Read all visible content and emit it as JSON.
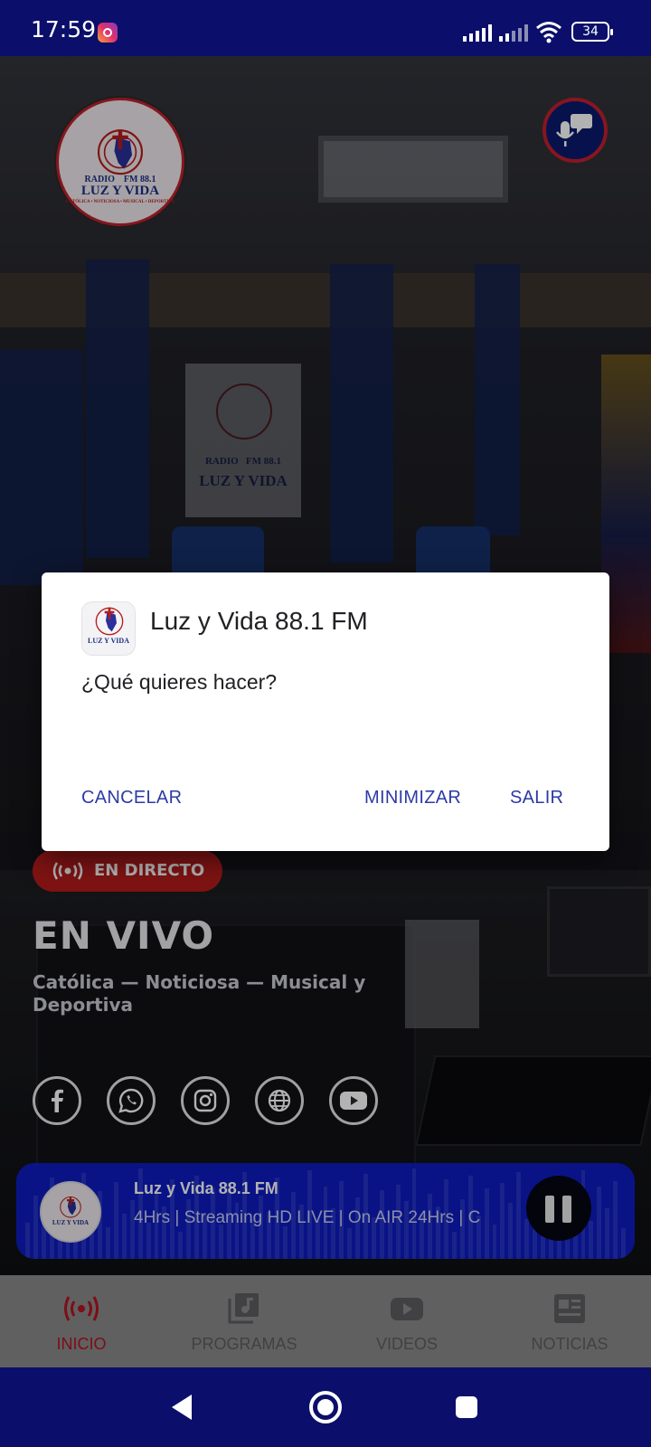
{
  "status_bar": {
    "time": "17:59",
    "battery": "34"
  },
  "logo": {
    "radio": "RADIO",
    "fm": "FM 88.1",
    "name": "LUZ Y VIDA",
    "tagline": "CATÓLICA • NOTICIOSA • MUSICAL • DEPORTIVA"
  },
  "poster": {
    "radio": "RADIO",
    "fm": "FM 88.1",
    "name": "LUZ Y VIDA"
  },
  "live": {
    "badge": "EN DIRECTO",
    "title": "EN VIVO",
    "subtitle": "Católica — Noticiosa — Musical y Deportiva"
  },
  "socials": [
    "facebook-icon",
    "whatsapp-icon",
    "instagram-icon",
    "globe-icon",
    "youtube-icon"
  ],
  "player": {
    "title": "Luz y Vida 88.1 FM",
    "subtitle": "4Hrs | Streaming HD LIVE | On AIR 24Hrs | C"
  },
  "bottom_nav": [
    {
      "label": "INICIO",
      "icon": "broadcast-icon",
      "active": true
    },
    {
      "label": "PROGRAMAS",
      "icon": "music-library-icon",
      "active": false
    },
    {
      "label": "VIDEOS",
      "icon": "youtube-icon",
      "active": false
    },
    {
      "label": "NOTICIAS",
      "icon": "news-icon",
      "active": false
    }
  ],
  "dialog": {
    "title": "Luz y Vida 88.1 FM",
    "message": "¿Qué quieres hacer?",
    "cancel": "CANCELAR",
    "minimize": "MINIMIZAR",
    "exit": "SALIR"
  },
  "colors": {
    "brand_blue": "#0b0f6b",
    "player_blue": "#0d1cc0",
    "live_red": "#b71c1c",
    "dialog_button": "#2d3aa5"
  }
}
